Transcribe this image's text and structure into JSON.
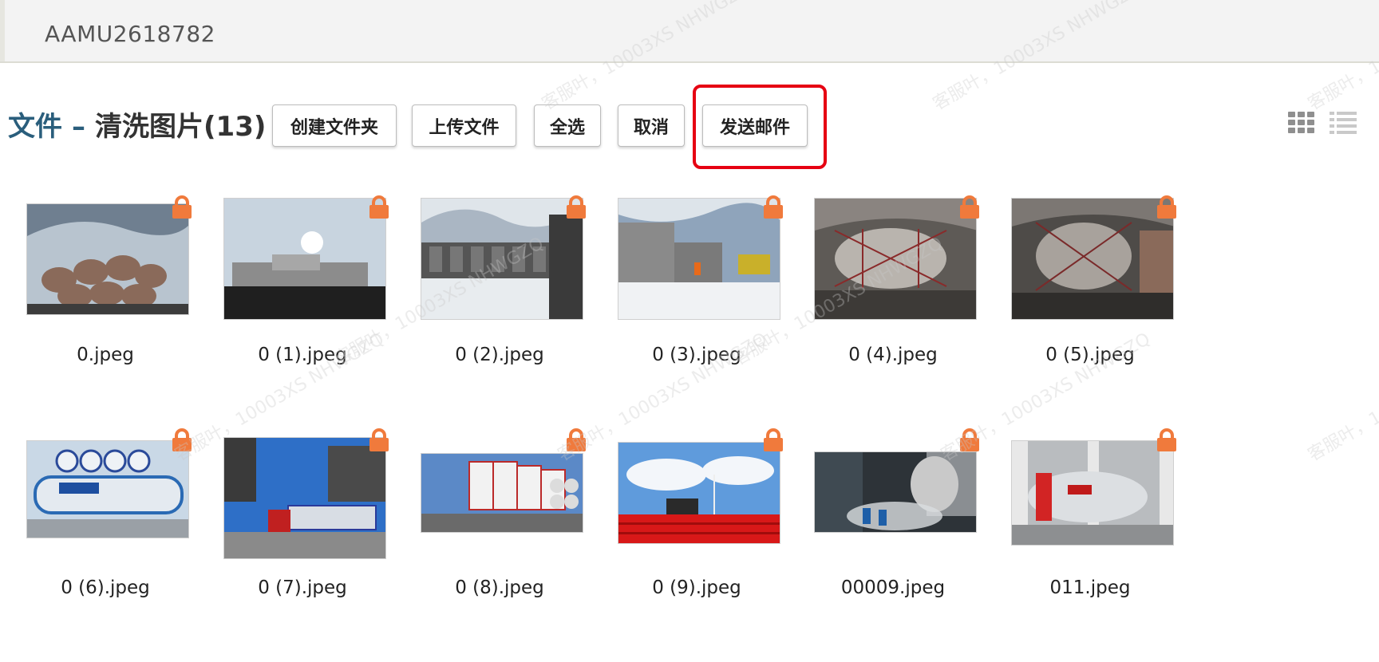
{
  "header": {
    "container_id": "AAMU2618782"
  },
  "toolbar": {
    "title_files": "文件",
    "title_dash": "–",
    "title_folder": "清洗图片(13)",
    "create_folder": "创建文件夹",
    "upload": "上传文件",
    "select_all": "全选",
    "cancel": "取消",
    "send_email": "发送邮件"
  },
  "view": {
    "grid_icon": "grid-view-icon",
    "list_icon": "list-view-icon"
  },
  "files": [
    {
      "name": "0.jpeg",
      "scene": "stacked-tanks-sky",
      "locked": true
    },
    {
      "name": "0 (1).jpeg",
      "scene": "truck-silhouette",
      "locked": true
    },
    {
      "name": "0 (2).jpeg",
      "scene": "snow-yard",
      "locked": true
    },
    {
      "name": "0 (3).jpeg",
      "scene": "snow-tanks",
      "locked": true
    },
    {
      "name": "0 (4).jpeg",
      "scene": "cargo-hold",
      "locked": true
    },
    {
      "name": "0 (5).jpeg",
      "scene": "cargo-hold-2",
      "locked": true
    },
    {
      "name": "0 (6).jpeg",
      "scene": "basf-tank",
      "locked": true
    },
    {
      "name": "0 (7).jpeg",
      "scene": "port-truck",
      "locked": true
    },
    {
      "name": "0 (8).jpeg",
      "scene": "tank-stacks",
      "locked": true
    },
    {
      "name": "0 (9).jpeg",
      "scene": "tulip-field",
      "locked": true
    },
    {
      "name": "00009.jpeg",
      "scene": "washing-bay",
      "locked": true
    },
    {
      "name": "011.jpeg",
      "scene": "tws-tank",
      "locked": true
    }
  ],
  "colors": {
    "accent_red": "#e60012",
    "lock_orange": "#f07a3c",
    "title_blue": "#2a5e7c"
  },
  "watermark_text": "客服叶，10003XS NHWGZQ"
}
